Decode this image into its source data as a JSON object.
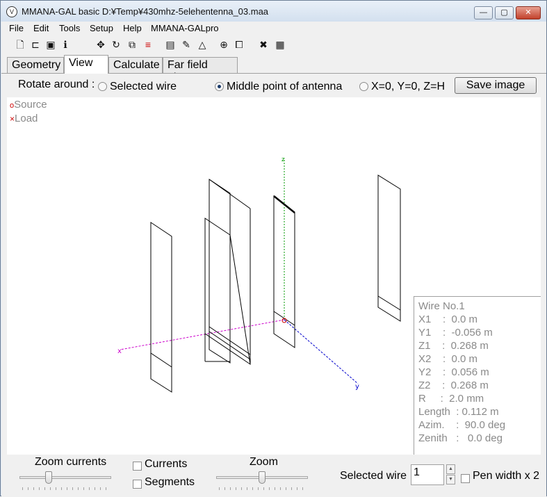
{
  "window": {
    "title": "MMANA-GAL basic D:¥Temp¥430mhz-5elehentenna_03.maa",
    "minimize": "—",
    "maximize": "▢",
    "close": "✕"
  },
  "menu": [
    "File",
    "Edit",
    "Tools",
    "Setup",
    "Help",
    "MMANA-GALpro"
  ],
  "toolbar_icons": [
    "new-file-icon",
    "open-folder-icon",
    "save-disk-icon",
    "info-icon",
    "move-arrows-icon",
    "rotate-icon",
    "resize-icon",
    "split-wire-icon",
    "document-icon",
    "eraser-icon",
    "triangle-icon",
    "crosshair-icon",
    "copy-icon",
    "tools-icon",
    "calculator-icon"
  ],
  "tabs": [
    "Geometry",
    "View",
    "Calculate",
    "Far field plots"
  ],
  "active_tab": "View",
  "rotate": {
    "label": "Rotate around :",
    "options": [
      "Selected wire",
      "Middle point of antenna",
      "X=0, Y=0, Z=H"
    ],
    "selected": "Middle point of antenna",
    "save_button": "Save image"
  },
  "legend": {
    "source": "Source",
    "load": "Load",
    "source_symbol": "o",
    "load_symbol": "×"
  },
  "axes": {
    "z": "z",
    "x": "x",
    "y": "y"
  },
  "colors": {
    "z_axis": "#009900",
    "x_axis": "#cc00cc",
    "y_axis": "#0000cc",
    "source": "#cc0000"
  },
  "wire_info": {
    "lines": [
      "Wire No.1",
      "X1    :  0.0 m",
      "Y1    :  -0.056 m",
      "Z1    :  0.268 m",
      "X2    :  0.0 m",
      "Y2    :  0.056 m",
      "Z2    :  0.268 m",
      "R     :  2.0 mm",
      "Length  : 0.112 m",
      "Azim.    :  90.0 deg",
      "Zenith   :   0.0 deg"
    ]
  },
  "bottom": {
    "zoom_currents": "Zoom currents",
    "currents": "Currents",
    "segments": "Segments",
    "zoom": "Zoom",
    "selected_wire_label": "Selected wire",
    "selected_wire_value": "1",
    "pen_width": "Pen width x 2"
  }
}
